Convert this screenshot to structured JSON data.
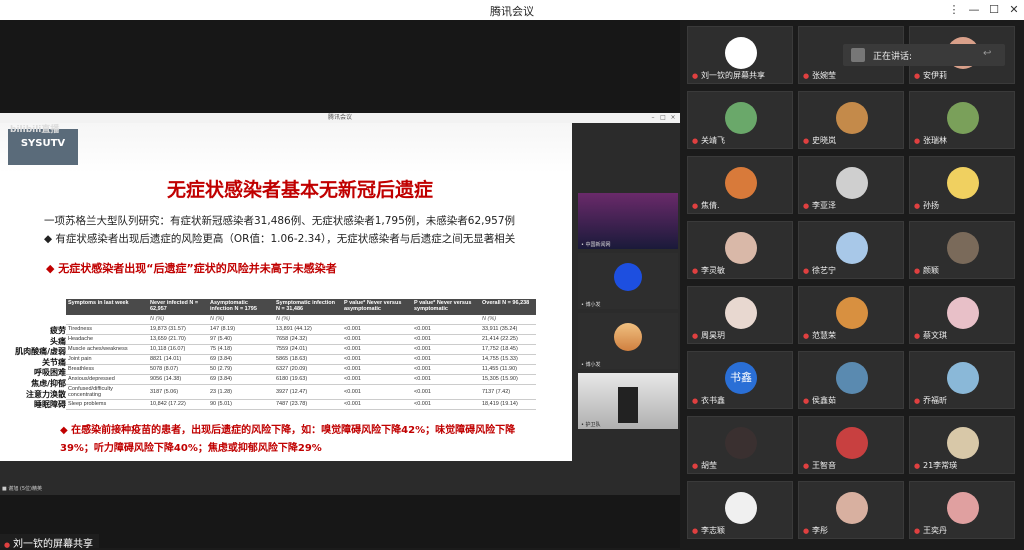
{
  "window": {
    "title": "腾讯会议",
    "min": "—",
    "max": "☐",
    "close": "✕",
    "pin": "⋮"
  },
  "share": {
    "inner_title": "腾讯会议",
    "logo": {
      "brand": "SYSUTV",
      "top": "bilibili直播"
    },
    "slide": {
      "title": "无症状感染者基本无新冠后遗症",
      "line1": "一项苏格兰大型队列研究：有症状新冠感染者31,486例、无症状感染者1,795例，未感染者62,957例",
      "line2": "◆ 有症状感染者出现后遗症的风险更高（OR值：1.06-2.34），无症状感染者与后遗症之间无显著相关",
      "red_heading": "◆ 无症状感染者出现“后遗症”症状的风险并未高于未感染者",
      "red_line1": "◆ 在感染前接种疫苗的患者，出现后遗症的风险下降，如：嗅觉障碍风险下降42%；味觉障碍风险下降",
      "red_line2": "39%；听力障碍风险下降40%；焦虑或抑郁风险下降29%",
      "table": {
        "headers": [
          "Symptoms in last week",
          "Never infected N = 62,957",
          "Asymptomatic infection N = 1795",
          "Symptomatic infection N = 31,486",
          "P value* Never versus asymptomatic",
          "P value* Never versus symptomatic",
          "Overall N = 96,238"
        ],
        "subrow": [
          "",
          "N (%)",
          "N (%)",
          "N (%)",
          "",
          "",
          "N (%)"
        ],
        "rows": [
          [
            "Tiredness",
            "19,873 (31.57)",
            "147 (8.19)",
            "13,891 (44.12)",
            "<0.001",
            "<0.001",
            "33,911 (35.24)"
          ],
          [
            "Headache",
            "13,659 (21.70)",
            "97 (5.40)",
            "7658 (24.32)",
            "<0.001",
            "<0.001",
            "21,414 (22.25)"
          ],
          [
            "Muscle aches/weakness",
            "10,118 (16.07)",
            "75 (4.18)",
            "7559 (24.01)",
            "<0.001",
            "<0.001",
            "17,752 (18.45)"
          ],
          [
            "Joint pain",
            "8821 (14.01)",
            "69 (3.84)",
            "5865 (18.63)",
            "<0.001",
            "<0.001",
            "14,755 (15.33)"
          ],
          [
            "Breathless",
            "5078 (8.07)",
            "50 (2.79)",
            "6327 (20.09)",
            "<0.001",
            "<0.001",
            "11,455 (11.90)"
          ],
          [
            "Anxious/depressed",
            "9056 (14.38)",
            "69 (3.84)",
            "6180 (19.63)",
            "<0.001",
            "<0.001",
            "15,305 (15.90)"
          ],
          [
            "Confused/difficulty concentrating",
            "3187 (5.06)",
            "23 (1.28)",
            "3927 (12.47)",
            "<0.001",
            "<0.001",
            "7137 (7.42)"
          ],
          [
            "Sleep problems",
            "10,842 (17.22)",
            "90 (5.01)",
            "7487 (23.78)",
            "<0.001",
            "<0.001",
            "18,419 (19.14)"
          ]
        ],
        "cn_labels": [
          "疲劳",
          "头痛",
          "肌肉酸痛/虚弱",
          "关节痛",
          "呼吸困难",
          "焦虑/抑郁",
          "注意力涣散",
          "睡眠障碍"
        ]
      }
    },
    "sharer_label": "刘一钦的屏幕共享"
  },
  "speaking": {
    "label": "正在讲话:"
  },
  "participants": [
    {
      "name": "刘一钦的屏幕共享",
      "color": "#ffffff"
    },
    {
      "name": "张婉莹",
      "color": "#2e2e2e"
    },
    {
      "name": "安伊莉",
      "color": "#d9a08a"
    },
    {
      "name": "关靖飞",
      "color": "#6aa86a"
    },
    {
      "name": "史晓岚",
      "color": "#c48a4a"
    },
    {
      "name": "张瑞林",
      "color": "#7aa05a"
    },
    {
      "name": "焦倩.",
      "color": "#d87a3a"
    },
    {
      "name": "李亚泽",
      "color": "#cfcfcf"
    },
    {
      "name": "孙扬",
      "color": "#f0d060"
    },
    {
      "name": "李灵敏",
      "color": "#d9b8a8"
    },
    {
      "name": "徐艺宁",
      "color": "#a8c8e8"
    },
    {
      "name": "颜颖",
      "color": "#7a6a5a"
    },
    {
      "name": "周昊玥",
      "color": "#e8d8d0"
    },
    {
      "name": "范慧荣",
      "color": "#d89040"
    },
    {
      "name": "蔡文琪",
      "color": "#e8c0c8"
    },
    {
      "name": "衣书鑫",
      "color": "#2a6fd6",
      "initials": "书鑫"
    },
    {
      "name": "侯鑫茹",
      "color": "#5a8ab0"
    },
    {
      "name": "乔福昕",
      "color": "#8ab8d8"
    },
    {
      "name": "胡莹",
      "color": "#3a3030"
    },
    {
      "name": "王智音",
      "color": "#c84040"
    },
    {
      "name": "21李常瑛",
      "color": "#d8c8a8"
    },
    {
      "name": "李志颖",
      "color": "#f0f0f0"
    },
    {
      "name": "李彤",
      "color": "#d8b0a0"
    },
    {
      "name": "王奕丹",
      "color": "#e0a0a0"
    }
  ],
  "side_thumbs": [
    {
      "label": "• 中国新闻网"
    },
    {
      "label": "• 博小发"
    },
    {
      "label": "• 博小发"
    },
    {
      "label": "• 护卫队"
    }
  ],
  "footer_tag": "■ 谢旭 (5位)精英"
}
